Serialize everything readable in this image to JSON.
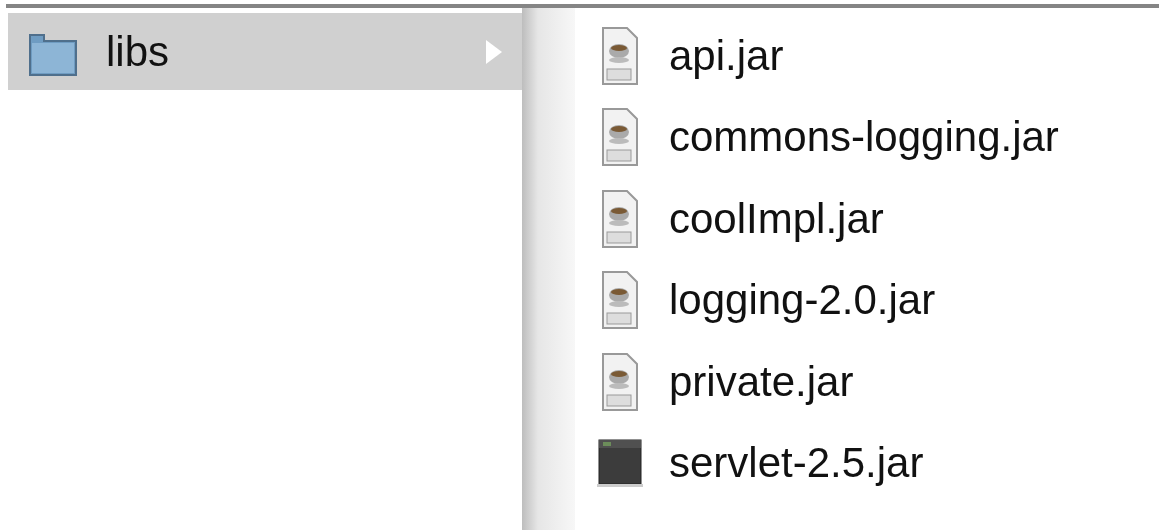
{
  "columns": [
    {
      "items": [
        {
          "name": "libs",
          "kind": "folder",
          "selected": true,
          "has_children": true
        }
      ]
    },
    {
      "items": [
        {
          "name": "api.jar",
          "kind": "jar",
          "selected": false
        },
        {
          "name": "commons-logging.jar",
          "kind": "jar",
          "selected": false
        },
        {
          "name": "coolImpl.jar",
          "kind": "jar",
          "selected": false
        },
        {
          "name": "logging-2.0.jar",
          "kind": "jar",
          "selected": false
        },
        {
          "name": "private.jar",
          "kind": "jar",
          "selected": false
        },
        {
          "name": "servlet-2.5.jar",
          "kind": "exec",
          "selected": false
        }
      ]
    }
  ]
}
